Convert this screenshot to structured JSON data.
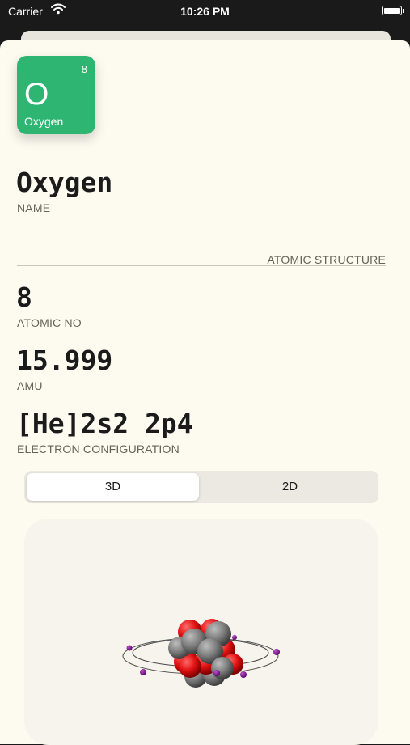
{
  "status_bar": {
    "carrier": "Carrier",
    "time": "10:26 PM"
  },
  "element": {
    "tile_number": "8",
    "tile_symbol": "O",
    "tile_name": "Oxygen",
    "tile_color": "#2fb572",
    "name": "Oxygen",
    "name_label": "NAME",
    "section_header": "ATOMIC STRUCTURE",
    "atomic_no": "8",
    "atomic_no_label": "ATOMIC NO",
    "amu": "15.999",
    "amu_label": "AMU",
    "electron_config": "[He]2s2 2p4",
    "electron_config_label": "ELECTRON CONFIGURATION"
  },
  "view_toggle": {
    "options": [
      "3D",
      "2D"
    ],
    "selected": "3D"
  },
  "model_colors": {
    "proton": "#e01010",
    "neutron": "#7d7d7d",
    "electron": "#7a1a8a"
  },
  "icons": {
    "wifi": "wifi-icon",
    "battery": "battery-icon"
  }
}
